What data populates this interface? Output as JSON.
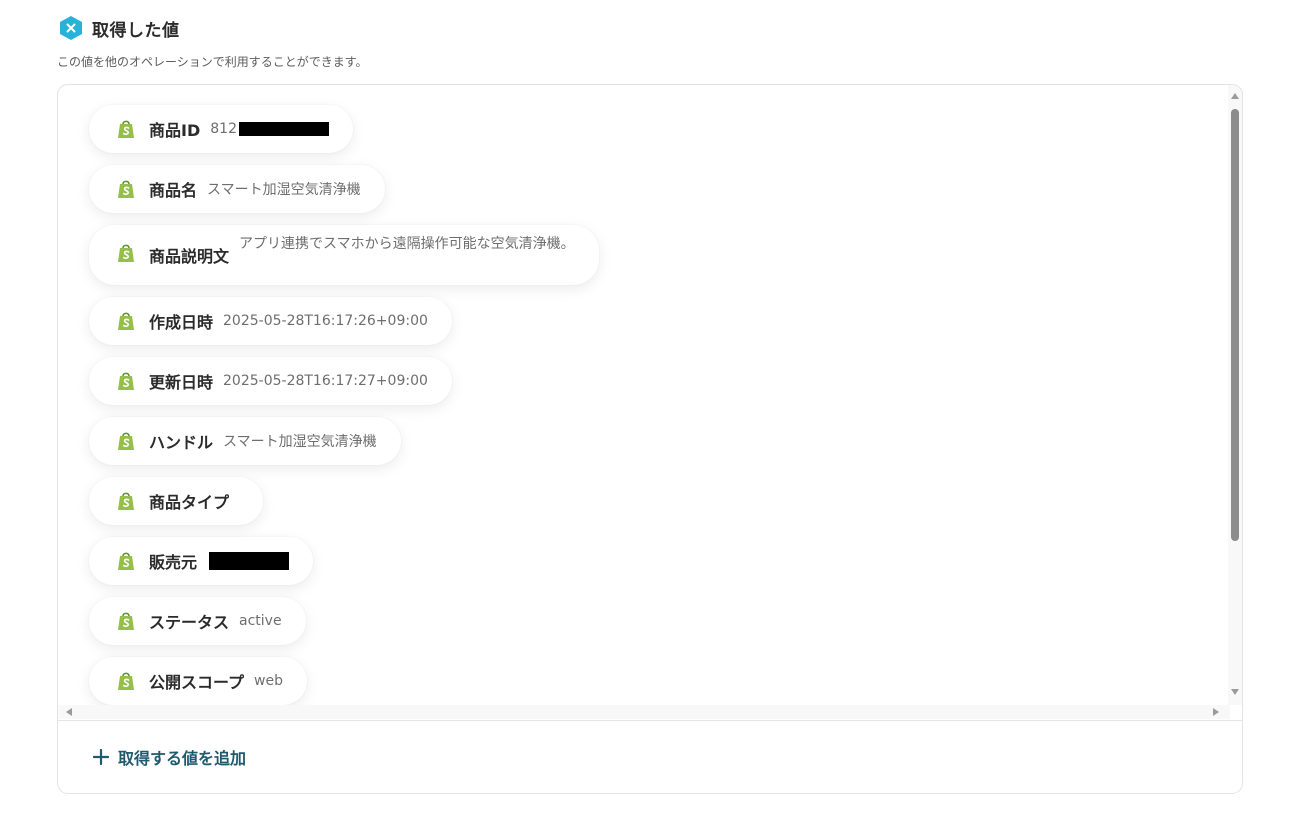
{
  "header": {
    "title": "取得した値",
    "subtitle": "この値を他のオペレーションで利用することができます。",
    "icon": "yoom-x-icon",
    "icon_color": "#27b3d8"
  },
  "items": [
    {
      "label": "商品ID",
      "value": "812",
      "redacted": true
    },
    {
      "label": "商品名",
      "value": "スマート加湿空気清浄機"
    },
    {
      "label": "商品説明文",
      "value": "アプリ連携でスマホから遠隔操作可能な空気清浄機。"
    },
    {
      "label": "作成日時",
      "value": "2025-05-28T16:17:26+09:00"
    },
    {
      "label": "更新日時",
      "value": "2025-05-28T16:17:27+09:00"
    },
    {
      "label": "ハンドル",
      "value": "スマート加湿空気清浄機"
    },
    {
      "label": "商品タイプ",
      "value": ""
    },
    {
      "label": "販売元",
      "value": "",
      "redacted": true
    },
    {
      "label": "ステータス",
      "value": "active"
    },
    {
      "label": "公開スコープ",
      "value": "web"
    }
  ],
  "item_icon": "shopify-bag-icon",
  "add_button": {
    "label": "取得する値を追加",
    "icon": "plus-icon",
    "color": "#1f5a6e"
  }
}
